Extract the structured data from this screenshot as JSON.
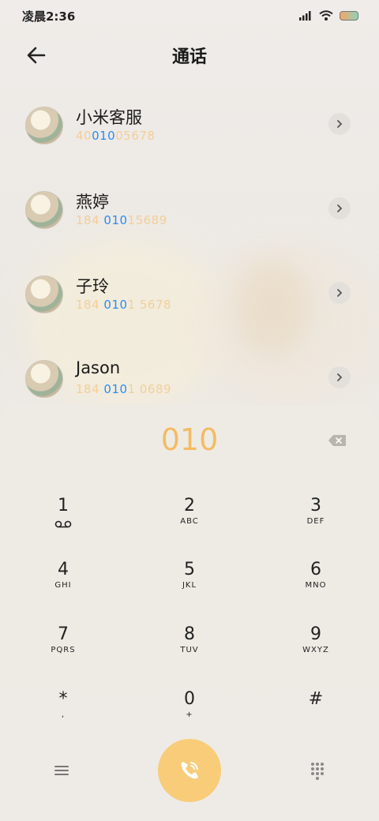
{
  "status_bar": {
    "time": "凌晨2:36"
  },
  "header": {
    "title": "通话"
  },
  "contacts": [
    {
      "name": "小米客服",
      "number_pre": "40",
      "number_hl": "010",
      "number_post": "05678"
    },
    {
      "name": "燕婷",
      "number_pre": "184 ",
      "number_hl": "010",
      "number_post": "15689"
    },
    {
      "name": "子玲",
      "number_pre": "184 ",
      "number_hl": "010",
      "number_post": "1 5678"
    },
    {
      "name": "Jason",
      "number_pre": "184 ",
      "number_hl": "010",
      "number_post": "1 0689"
    }
  ],
  "dialer": {
    "input_value": "010",
    "keys": [
      {
        "digit": "1",
        "letters": ""
      },
      {
        "digit": "2",
        "letters": "ABC"
      },
      {
        "digit": "3",
        "letters": "DEF"
      },
      {
        "digit": "4",
        "letters": "GHI"
      },
      {
        "digit": "5",
        "letters": "JKL"
      },
      {
        "digit": "6",
        "letters": "MNO"
      },
      {
        "digit": "7",
        "letters": "PQRS"
      },
      {
        "digit": "8",
        "letters": "TUV"
      },
      {
        "digit": "9",
        "letters": "WXYZ"
      },
      {
        "digit": "*",
        "letters": ","
      },
      {
        "digit": "0",
        "letters": "+"
      },
      {
        "digit": "#",
        "letters": ""
      }
    ]
  },
  "icons": {
    "back": "back-arrow-icon",
    "chevron": "chevron-right-icon",
    "backspace": "backspace-icon",
    "voicemail": "voicemail-icon",
    "menu": "menu-icon",
    "call": "phone-call-icon",
    "keypad": "keypad-grid-icon"
  },
  "colors": {
    "accent": "#f5bb63",
    "match_highlight": "#2b8cf0",
    "number_text": "#f3cf98",
    "call_button": "#f8cc79"
  }
}
